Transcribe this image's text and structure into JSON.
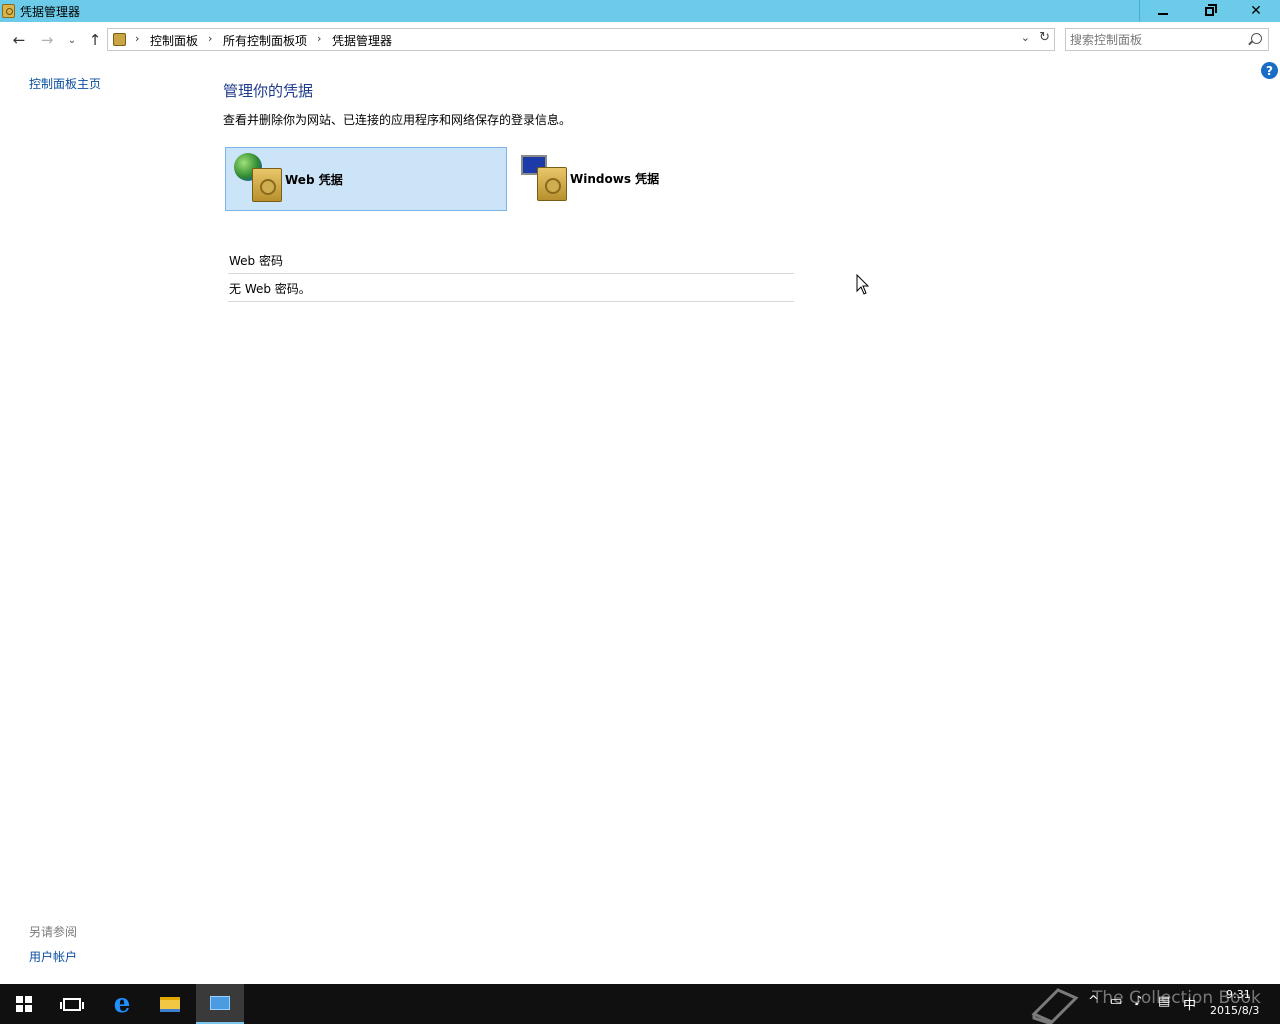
{
  "window": {
    "title": "凭据管理器"
  },
  "nav": {
    "breadcrumbs": [
      "控制面板",
      "所有控制面板项",
      "凭据管理器"
    ],
    "search_placeholder": "搜索控制面板"
  },
  "left_pane": {
    "home_link": "控制面板主页",
    "see_also_heading": "另请参阅",
    "see_also_links": [
      "用户帐户"
    ]
  },
  "main": {
    "title": "管理你的凭据",
    "description": "查看并删除你为网站、已连接的应用程序和网络保存的登录信息。",
    "tiles": [
      {
        "label": "Web 凭据",
        "selected": true,
        "icon": "globe-safe-icon"
      },
      {
        "label": "Windows 凭据",
        "selected": false,
        "icon": "monitor-safe-icon"
      }
    ],
    "section": {
      "heading": "Web 密码",
      "empty_text": "无 Web 密码。"
    }
  },
  "taskbar": {
    "watermark": "The Collection Book",
    "clock": {
      "time": "9:31",
      "date": "2015/8/3"
    },
    "ime": "中"
  },
  "colors": {
    "titlebar": "#6ccbe8",
    "link": "#0a4ea0",
    "selected_tile_bg": "#cce4f7",
    "selected_tile_border": "#7eb4ea",
    "taskbar": "#101010"
  }
}
